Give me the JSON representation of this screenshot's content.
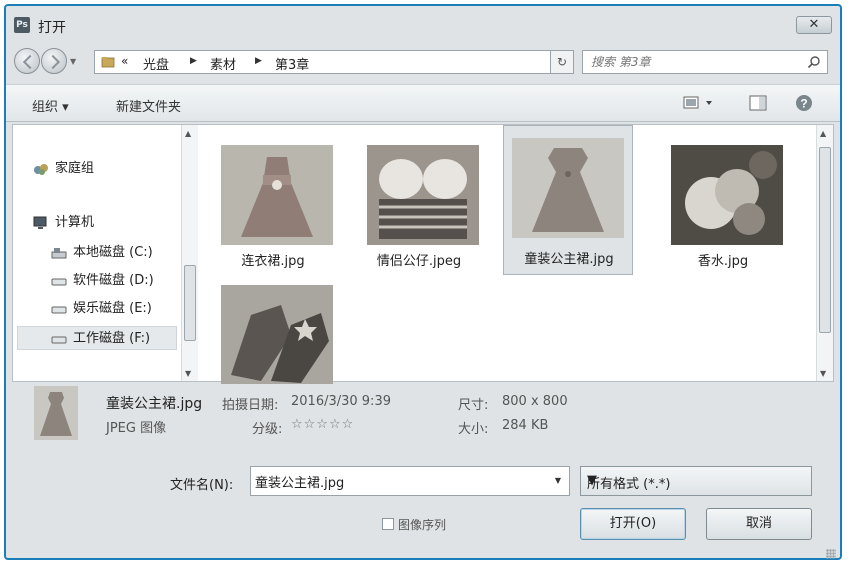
{
  "window": {
    "app_icon_text": "Ps",
    "title": "打开",
    "close_label": "✕"
  },
  "nav": {
    "breadcrumb": {
      "chevrons": "«",
      "items": [
        "光盘",
        "素材",
        "第3章"
      ]
    },
    "search_placeholder": "搜索 第3章"
  },
  "toolbar": {
    "organize_label": "组织 ▾",
    "new_folder_label": "新建文件夹"
  },
  "sidebar": {
    "items": [
      {
        "label": "家庭组",
        "icon": "homegroup-icon"
      },
      {
        "label": "计算机",
        "icon": "computer-icon"
      },
      {
        "label": "本地磁盘 (C:)",
        "icon": "system-drive-icon"
      },
      {
        "label": "软件磁盘 (D:)",
        "icon": "drive-icon"
      },
      {
        "label": "娱乐磁盘 (E:)",
        "icon": "drive-icon"
      },
      {
        "label": "工作磁盘 (F:)",
        "icon": "drive-icon",
        "selected": true
      }
    ]
  },
  "files": [
    {
      "name": "连衣裙.jpg"
    },
    {
      "name": "情侣公仔.jpeg"
    },
    {
      "name": "童装公主裙.jpg",
      "selected": true
    },
    {
      "name": "香水.jpg"
    },
    {
      "name": ""
    }
  ],
  "details": {
    "file_name": "童装公主裙.jpg",
    "file_type": "JPEG 图像",
    "date_label": "拍摄日期:",
    "date_value": "2016/3/30 9:39",
    "rating_label": "分级:",
    "rating_value": 0,
    "rating_stars": "☆☆☆☆☆",
    "dimensions_label": "尺寸:",
    "dimensions_value": "800 x 800",
    "size_label": "大小:",
    "size_value": "284 KB"
  },
  "footer": {
    "filename_label": "文件名(N):",
    "filename_value": "童装公主裙.jpg",
    "filetype_value": "所有格式 (*.*)",
    "image_sequence_label": "图像序列",
    "image_sequence_checked": false,
    "open_label": "打开(O)",
    "cancel_label": "取消"
  },
  "colors": {
    "frame": "#1a7fb8",
    "dialog_bg": "#dfe3e5",
    "selection": "#dfe3e6"
  }
}
